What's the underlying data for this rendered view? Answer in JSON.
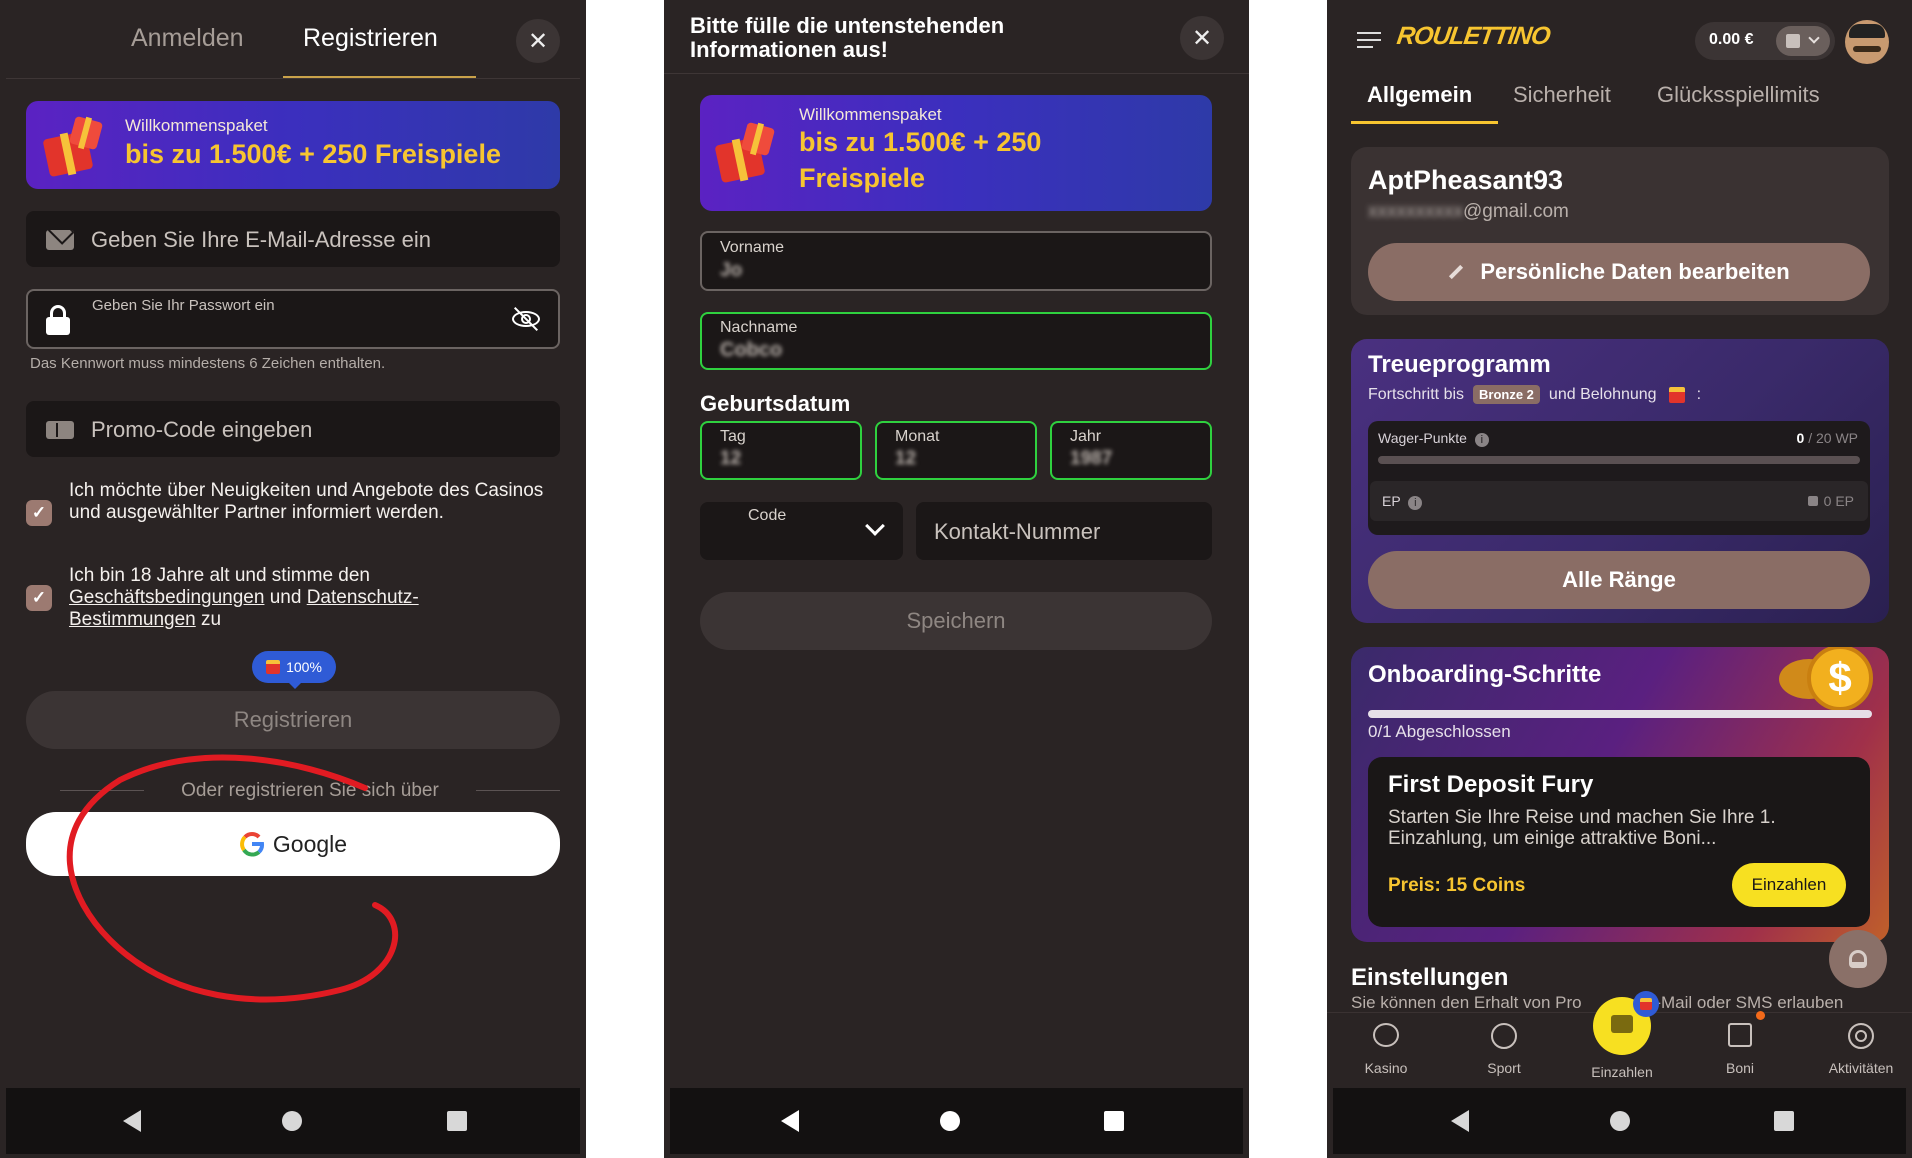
{
  "colors": {
    "background": "#2a2424",
    "accent_yellow": "#f7c530",
    "button_brown": "#8a6d65",
    "green_border": "#2fd13f",
    "promo_purple": "#5b22c2"
  },
  "left": {
    "tabs": [
      "Anmelden",
      "Registrieren"
    ],
    "close_icon": "close-icon",
    "promo": {
      "title": "Willkommenspaket",
      "main": "bis zu 1.500€ + 250 Freispiele"
    },
    "email_placeholder": "Geben Sie Ihre E-Mail-Adresse ein",
    "password_label": "Geben Sie Ihr Passwort ein",
    "password_hint": "Das Kennwort muss mindestens 6 Zeichen enthalten.",
    "promo_code_placeholder": "Promo-Code eingeben",
    "consent_news": "Ich möchte über Neuigkeiten und Angebote des Casinos und ausgewählter Partner informiert werden.",
    "consent_age_prefix": "Ich bin 18 Jahre alt und stimme den",
    "consent_terms_link": "Geschäftsbedingungen",
    "consent_and": "und",
    "consent_privacy_link": "Datenschutz-Bestimmungen",
    "consent_suffix": "zu",
    "progress_badge": "100%",
    "register_button": "Registrieren",
    "divider_text": "Oder registrieren Sie sich über",
    "google_button": "Google"
  },
  "middle": {
    "header": "Bitte fülle die untenstehenden Informationen aus!",
    "promo": {
      "title": "Willkommenspaket",
      "line1": "bis zu 1.500€ + 250",
      "line2": "Freispiele"
    },
    "first_name_label": "Vorname",
    "first_name_value": "Jo",
    "last_name_label": "Nachname",
    "last_name_value": "Cobco",
    "birthdate_heading": "Geburtsdatum",
    "day_label": "Tag",
    "day_value": "12",
    "month_label": "Monat",
    "month_value": "12",
    "year_label": "Jahr",
    "year_value": "1987",
    "code_label": "Code",
    "phone_placeholder": "Kontakt-Nummer",
    "save_button": "Speichern"
  },
  "right": {
    "logo": "ROULETTINO",
    "balance": "0.00 €",
    "tabs": [
      "Allgemein",
      "Sicherheit",
      "Glücksspiellimits"
    ],
    "username": "AptPheasant93",
    "email_visible": "@gmail.com",
    "email_blurred": "xxxxxxxxxx",
    "edit_button": "Persönliche Daten bearbeiten",
    "loyalty": {
      "title": "Treueprogramm",
      "progress_prefix": "Fortschritt bis",
      "rank_badge": "Bronze 2",
      "progress_suffix": "und Belohnung",
      "colon": ":",
      "wager_label": "Wager-Punkte",
      "wager_current": "0",
      "wager_total": "/ 20 WP",
      "wager_progress": 0,
      "ep_label": "EP",
      "ep_value": "0 EP",
      "all_ranks_button": "Alle Ränge"
    },
    "onboarding": {
      "title": "Onboarding-Schritte",
      "status": "0/1 Abgeschlossen",
      "progress": 0,
      "task_title": "First Deposit Fury",
      "task_desc": "Starten Sie Ihre Reise und machen Sie Ihre 1. Einzahlung, um einige attraktive Boni...",
      "prize": "Preis: 15 Coins",
      "deposit_button": "Einzahlen"
    },
    "settings": {
      "title": "Einstellungen",
      "desc_start": "Sie können den Erhalt von Pro",
      "desc_end": "r E-Mail oder SMS erlauben"
    },
    "bottom_nav": [
      "Kasino",
      "Sport",
      "Einzahlen",
      "Boni",
      "Aktivitäten"
    ]
  }
}
